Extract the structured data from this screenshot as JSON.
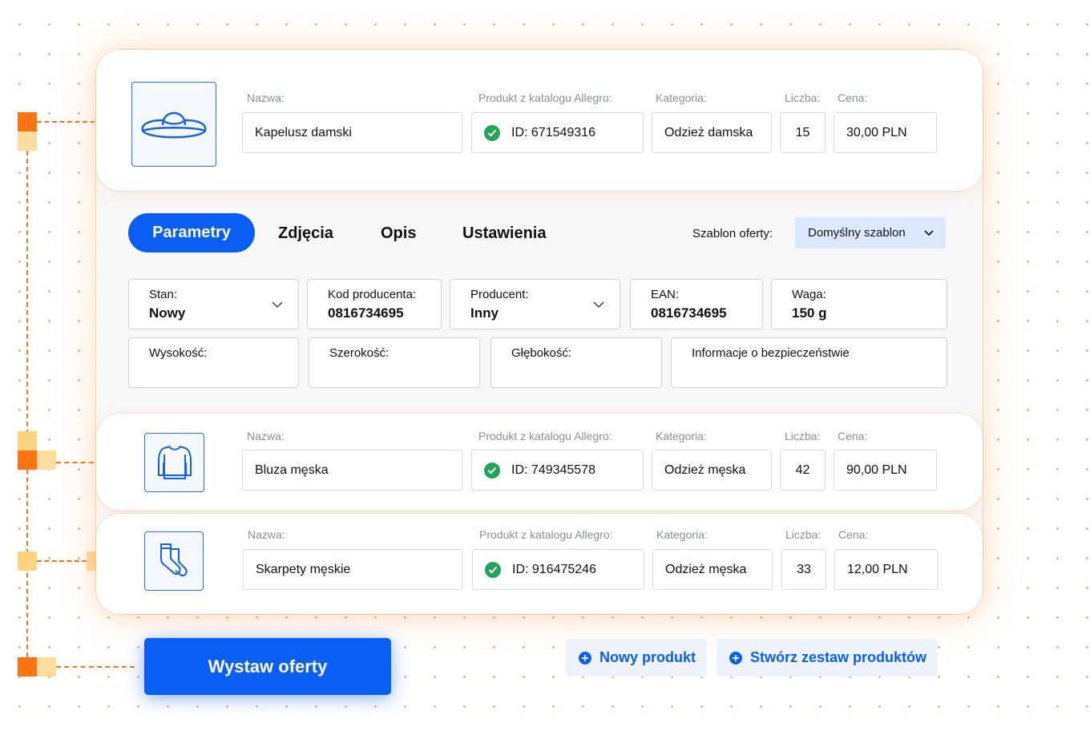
{
  "products": [
    {
      "icon": "hat-icon",
      "name_label": "Nazwa:",
      "name": "Kapelusz damski",
      "catalog_label": "Produkt z katalogu Allegro:",
      "catalog_id": "ID: 671549316",
      "category_label": "Kategoria:",
      "category": "Odzież damska",
      "qty_label": "Liczba:",
      "qty": "15",
      "price_label": "Cena:",
      "price": "30,00 PLN"
    },
    {
      "icon": "sweatshirt-icon",
      "name_label": "Nazwa:",
      "name": "Bluza męska",
      "catalog_label": "Produkt z katalogu Allegro:",
      "catalog_id": "ID: 749345578",
      "category_label": "Kategoria:",
      "category": "Odzież męska",
      "qty_label": "Liczba:",
      "qty": "42",
      "price_label": "Cena:",
      "price": "90,00 PLN"
    },
    {
      "icon": "socks-icon",
      "name_label": "Nazwa:",
      "name": "Skarpety męskie",
      "catalog_label": "Produkt z katalogu Allegro:",
      "catalog_id": "ID: 916475246",
      "category_label": "Kategoria:",
      "category": "Odzież męska",
      "qty_label": "Liczba:",
      "qty": "33",
      "price_label": "Cena:",
      "price": "12,00 PLN"
    }
  ],
  "tabs": {
    "parametry": "Parametry",
    "zdjecia": "Zdjęcia",
    "opis": "Opis",
    "ustawienia": "Ustawienia",
    "active": "Parametry"
  },
  "template": {
    "label": "Szablon oferty:",
    "value": "Domyślny szablon"
  },
  "params": {
    "stan_label": "Stan:",
    "stan_value": "Nowy",
    "kod_label": "Kod producenta:",
    "kod_value": "0816734695",
    "producent_label": "Producent:",
    "producent_value": "Inny",
    "ean_label": "EAN:",
    "ean_value": "0816734695",
    "waga_label": "Waga:",
    "waga_value": "150 g",
    "wysokosc_label": "Wysokość:",
    "szerokosc_label": "Szerokość:",
    "glebokosc_label": "Głębokość:",
    "bezpieczenstwo_label": "Informacje o bezpieczeństwie"
  },
  "actions": {
    "publish": "Wystaw oferty",
    "new_product": "Nowy produkt",
    "create_set": "Stwórz zestaw produktów"
  },
  "colors": {
    "primary": "#0a5ef4",
    "accent_orange": "#ff7410",
    "accent_yellow": "#ffd280",
    "success": "#22a55a"
  }
}
